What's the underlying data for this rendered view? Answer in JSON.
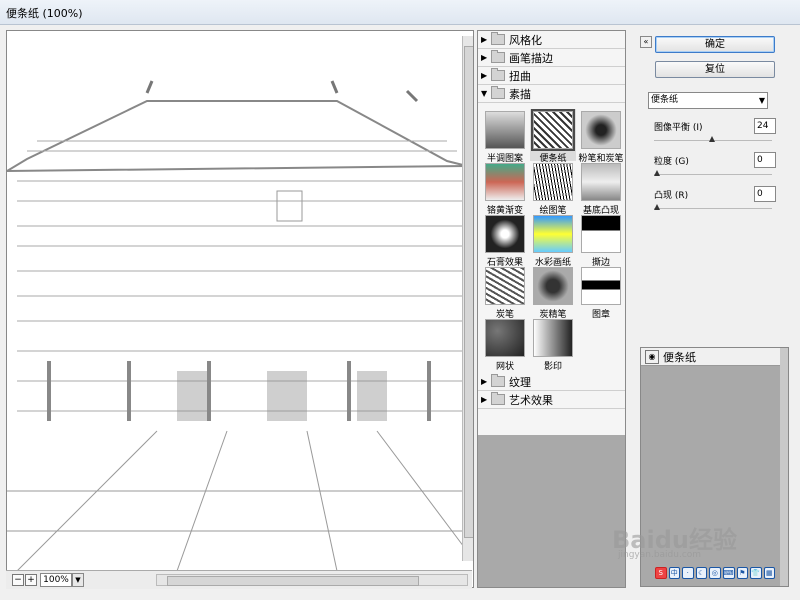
{
  "window": {
    "title": "便条纸 (100%)"
  },
  "preview": {
    "zoom": "100%"
  },
  "filter_categories": [
    {
      "label": "风格化",
      "expanded": false
    },
    {
      "label": "画笔描边",
      "expanded": false
    },
    {
      "label": "扭曲",
      "expanded": false
    },
    {
      "label": "素描",
      "expanded": true
    },
    {
      "label": "纹理",
      "expanded": false
    },
    {
      "label": "艺术效果",
      "expanded": false
    }
  ],
  "sketch_filters": [
    {
      "label": "半调图案",
      "selected": false
    },
    {
      "label": "便条纸",
      "selected": true
    },
    {
      "label": "粉笔和炭笔",
      "selected": false
    },
    {
      "label": "铬黄渐变",
      "selected": false
    },
    {
      "label": "绘图笔",
      "selected": false
    },
    {
      "label": "基底凸现",
      "selected": false
    },
    {
      "label": "石膏效果",
      "selected": false
    },
    {
      "label": "水彩画纸",
      "selected": false
    },
    {
      "label": "撕边",
      "selected": false
    },
    {
      "label": "炭笔",
      "selected": false
    },
    {
      "label": "炭精笔",
      "selected": false
    },
    {
      "label": "图章",
      "selected": false
    },
    {
      "label": "网状",
      "selected": false
    },
    {
      "label": "影印",
      "selected": false
    }
  ],
  "buttons": {
    "ok": "确定",
    "reset": "复位"
  },
  "filter_select": {
    "value": "便条纸"
  },
  "params": [
    {
      "label": "图像平衡 (I)",
      "value": "24",
      "fraction": 0.48
    },
    {
      "label": "粒度 (G)",
      "value": "0",
      "fraction": 0.0
    },
    {
      "label": "凸现 (R)",
      "value": "0",
      "fraction": 0.0
    }
  ],
  "layers": [
    {
      "name": "便条纸"
    }
  ],
  "watermark": {
    "brand": "Baidu经验",
    "url": "jingyan.baidu.com"
  },
  "tray_icons": [
    "S",
    "中",
    "·",
    "☾",
    "◎",
    "⌨",
    "⚑",
    "👕",
    "▦"
  ]
}
